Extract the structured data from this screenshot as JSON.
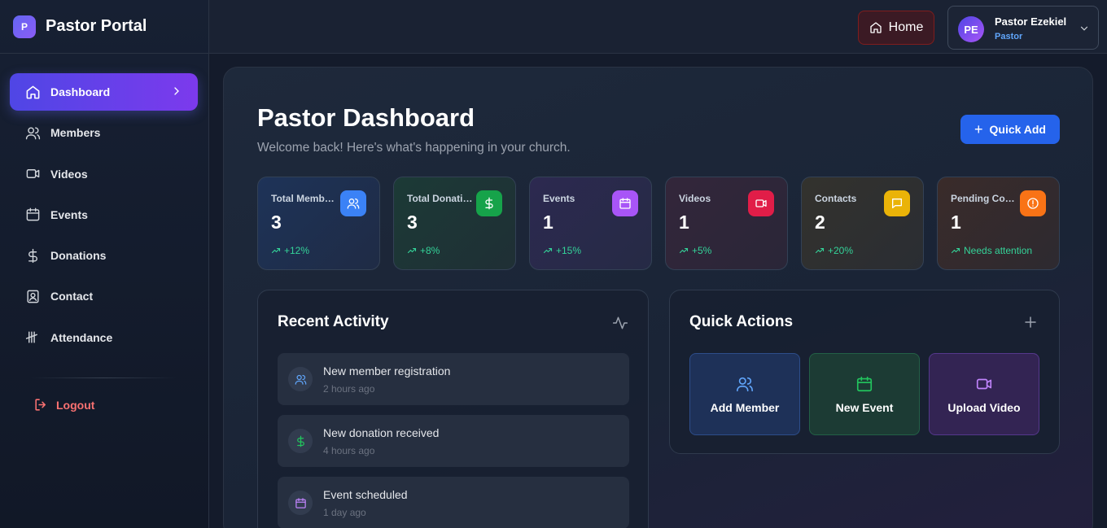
{
  "app": {
    "logo_letter": "P",
    "name": "Pastor Portal"
  },
  "sidebar": {
    "items": [
      {
        "label": "Dashboard",
        "icon": "home-icon"
      },
      {
        "label": "Members",
        "icon": "users-icon"
      },
      {
        "label": "Videos",
        "icon": "video-icon"
      },
      {
        "label": "Events",
        "icon": "calendar-icon"
      },
      {
        "label": "Donations",
        "icon": "dollar-icon"
      },
      {
        "label": "Contact",
        "icon": "contact-icon"
      },
      {
        "label": "Attendance",
        "icon": "tally-icon"
      }
    ],
    "logout_label": "Logout"
  },
  "header": {
    "home_label": "Home",
    "user": {
      "initials": "PE",
      "name": "Pastor Ezekiel",
      "role": "Pastor"
    }
  },
  "main": {
    "title": "Pastor Dashboard",
    "subtitle": "Welcome back! Here's what's happening in your church.",
    "quick_add_label": "Quick Add",
    "stats": [
      {
        "label": "Total Members",
        "value": "3",
        "trend": "+12%",
        "icon": "users-icon",
        "color": "#3b82f6"
      },
      {
        "label": "Total Donations",
        "value": "3",
        "trend": "+8%",
        "icon": "dollar-icon",
        "color": "#16a34a"
      },
      {
        "label": "Events",
        "value": "1",
        "trend": "+15%",
        "icon": "calendar-icon",
        "color": "#a855f7"
      },
      {
        "label": "Videos",
        "value": "1",
        "trend": "+5%",
        "icon": "video-icon",
        "color": "#e11d48"
      },
      {
        "label": "Contacts",
        "value": "2",
        "trend": "+20%",
        "icon": "message-icon",
        "color": "#eab308"
      },
      {
        "label": "Pending Contacts",
        "value": "1",
        "trend": "Needs attention",
        "icon": "alert-icon",
        "color": "#f97316"
      }
    ],
    "recent_activity": {
      "title": "Recent Activity",
      "items": [
        {
          "title": "New member registration",
          "time": "2 hours ago",
          "icon": "users-icon"
        },
        {
          "title": "New donation received",
          "time": "4 hours ago",
          "icon": "dollar-icon"
        },
        {
          "title": "Event scheduled",
          "time": "1 day ago",
          "icon": "calendar-icon"
        }
      ]
    },
    "quick_actions": {
      "title": "Quick Actions",
      "items": [
        {
          "label": "Add Member",
          "icon": "users-icon"
        },
        {
          "label": "New Event",
          "icon": "calendar-icon"
        },
        {
          "label": "Upload Video",
          "icon": "video-icon"
        }
      ]
    }
  }
}
